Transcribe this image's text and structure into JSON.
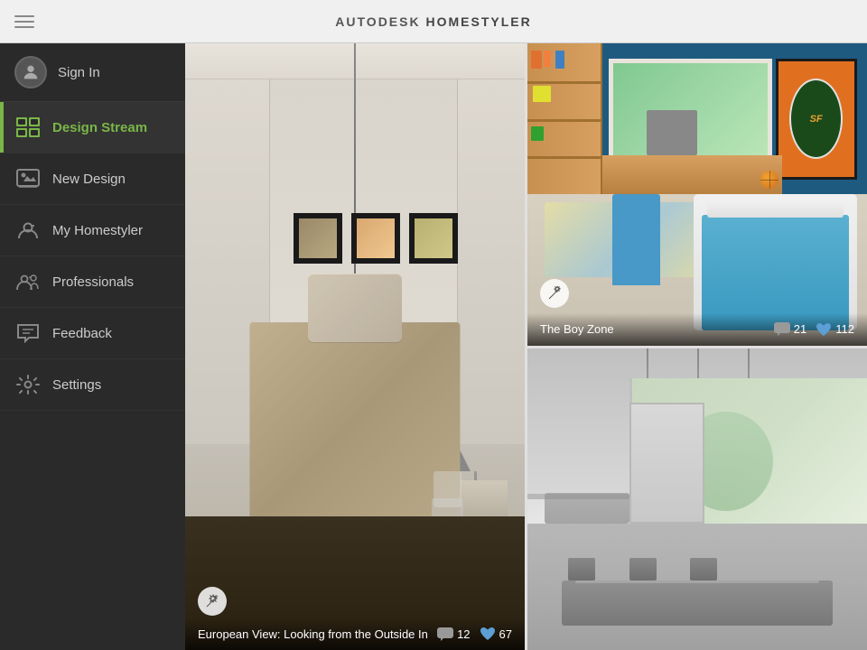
{
  "header": {
    "title_prefix": "AUTODESK",
    "title_suffix": "HOMESTYLER",
    "trademark": "®"
  },
  "sidebar": {
    "sign_in_label": "Sign In",
    "items": [
      {
        "id": "design-stream",
        "label": "Design Stream",
        "active": true
      },
      {
        "id": "new-design",
        "label": "New Design",
        "active": false
      },
      {
        "id": "my-homestyler",
        "label": "My Homestyler",
        "active": false
      },
      {
        "id": "professionals",
        "label": "Professionals",
        "active": false
      },
      {
        "id": "feedback",
        "label": "Feedback",
        "active": false
      },
      {
        "id": "settings",
        "label": "Settings",
        "active": false
      }
    ]
  },
  "designs": [
    {
      "id": "design-1",
      "title": "European View: Looking from the Outside In",
      "comments": "12",
      "likes": "67",
      "size": "large"
    },
    {
      "id": "design-2",
      "title": "The Boy Zone",
      "comments": "21",
      "likes": "112",
      "size": "small-top"
    },
    {
      "id": "design-3",
      "title": "",
      "comments": "",
      "likes": "",
      "size": "small-bottom"
    }
  ]
}
